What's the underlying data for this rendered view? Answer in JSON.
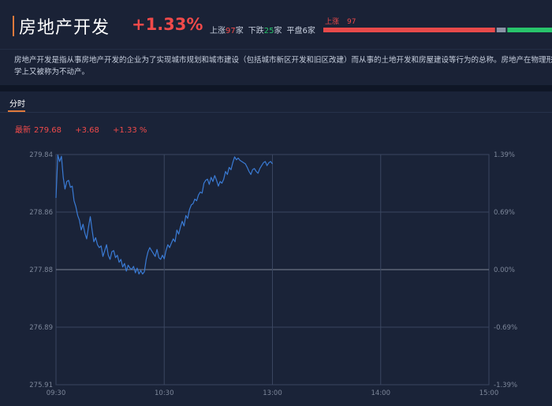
{
  "header": {
    "title": "房地产开发",
    "change": "+1.33%",
    "up_label": "上涨",
    "up_count": "97",
    "down_label": "下跌",
    "down_count": "25",
    "flat_label": "平盘",
    "flat_count": "6",
    "unit": "家",
    "bar_label": "上涨",
    "bar_count": "97"
  },
  "breadth": {
    "up": 97,
    "flat": 6,
    "down": 25,
    "up_color": "#e84a4a",
    "flat_color": "#8a93a6",
    "down_color": "#28c46b"
  },
  "description": {
    "line1": "房地产开发是指从事房地产开发的企业为了实现城市规划和城市建设（包括城市新区开发和旧区改建）而从事的土地开发和房屋建设等行为的总称。房地产在物理形态上和经济",
    "line2": "学上又被称为不动产。"
  },
  "tabs": [
    {
      "label": "分时",
      "active": true
    }
  ],
  "quote": {
    "latest_label": "最新",
    "latest": "279.68",
    "change": "+3.68",
    "pct": "+1.33 %"
  },
  "colors": {
    "line": "#3a7bd5",
    "up": "#f04a4a",
    "grid": "#3a4660",
    "zero_line": "#7d8596"
  },
  "chart_data": {
    "type": "line",
    "title": "",
    "xlabel": "",
    "ylabel": "",
    "x_ticks": [
      "09:30",
      "10:30",
      "13:00",
      "14:00",
      "15:00"
    ],
    "y_ticks_left": [
      "279.84",
      "278.86",
      "277.88",
      "276.89",
      "275.91"
    ],
    "y_ticks_right": [
      "1.39%",
      "0.69%",
      "0.00%",
      "-0.69%",
      "-1.39%"
    ],
    "ylim": [
      275.91,
      279.84
    ],
    "prev_close": 277.88,
    "session_minutes": 240,
    "grid": true,
    "series": [
      {
        "x": [
          0,
          1,
          2,
          3,
          4,
          5,
          6,
          7,
          8,
          9,
          10,
          11,
          12,
          13,
          14,
          15,
          16,
          17,
          18,
          19,
          20,
          21,
          22,
          23,
          24,
          25,
          26,
          27,
          28,
          29,
          30,
          31,
          32,
          33,
          34,
          35,
          36,
          37,
          38,
          39,
          40,
          41,
          42,
          43,
          44,
          45,
          46,
          47,
          48,
          49,
          50,
          51,
          52,
          53,
          54,
          55,
          56,
          57,
          58,
          59,
          60,
          61,
          62,
          63,
          64,
          65,
          66,
          67,
          68,
          69,
          70,
          71,
          72,
          73,
          74,
          75,
          76,
          77,
          78,
          79,
          80,
          81,
          82,
          83,
          84,
          85,
          86,
          87,
          88,
          89,
          90,
          91,
          92,
          93,
          94,
          95,
          96,
          97,
          98,
          99,
          100,
          101,
          102,
          103,
          104,
          105,
          106,
          107,
          108,
          109,
          110,
          111,
          112,
          113,
          114,
          115,
          116,
          117,
          118,
          119,
          120
        ],
        "values": [
          279.1,
          279.83,
          279.72,
          279.81,
          279.45,
          279.25,
          279.38,
          279.4,
          279.28,
          279.3,
          279.05,
          278.95,
          278.8,
          278.72,
          278.55,
          278.65,
          278.5,
          278.4,
          278.6,
          278.78,
          278.55,
          278.35,
          278.42,
          278.3,
          278.25,
          278.28,
          278.1,
          278.2,
          278.3,
          278.12,
          278.05,
          278.18,
          278.2,
          278.08,
          278.12,
          278.0,
          278.05,
          277.92,
          277.98,
          277.85,
          277.95,
          277.9,
          277.88,
          277.93,
          277.82,
          277.9,
          277.8,
          277.86,
          277.8,
          277.84,
          278.05,
          278.18,
          278.25,
          278.2,
          278.15,
          278.1,
          278.22,
          278.08,
          278.05,
          278.12,
          278.06,
          278.2,
          278.3,
          278.25,
          278.33,
          278.4,
          278.35,
          278.55,
          278.48,
          278.6,
          278.7,
          278.62,
          278.8,
          278.75,
          278.9,
          278.98,
          279.0,
          279.08,
          279.05,
          279.15,
          279.2,
          279.18,
          279.35,
          279.4,
          279.42,
          279.33,
          279.45,
          279.38,
          279.48,
          279.4,
          279.3,
          279.38,
          279.35,
          279.42,
          279.55,
          279.5,
          279.62,
          279.58,
          279.7,
          279.8,
          279.75,
          279.78,
          279.74,
          279.72,
          279.7,
          279.68,
          279.62,
          279.55,
          279.5,
          279.58,
          279.6,
          279.55,
          279.52,
          279.6,
          279.65,
          279.7,
          279.72,
          279.65,
          279.7,
          279.72,
          279.68
        ]
      }
    ]
  }
}
